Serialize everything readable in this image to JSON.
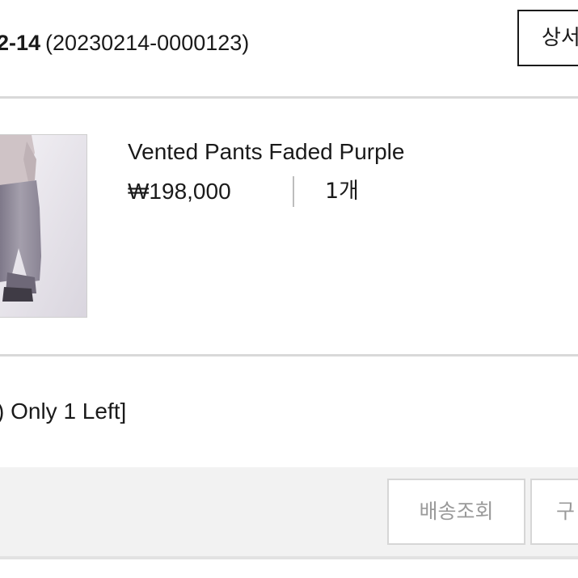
{
  "order": {
    "date": "2-14",
    "number": "(20230214-0000123)",
    "detail_label": "상서"
  },
  "product": {
    "name": "Vented Pants Faded Purple",
    "price": "₩198,000",
    "quantity": "1개"
  },
  "note": ") Only 1 Left]",
  "actions": {
    "track_label": "배송조회",
    "buy_label": "구"
  },
  "colors": {
    "text": "#1a1a1a",
    "divider": "#d9d9d9",
    "action_bar_bg": "#f2f2f2",
    "button_text_muted": "#9a9a9a"
  }
}
